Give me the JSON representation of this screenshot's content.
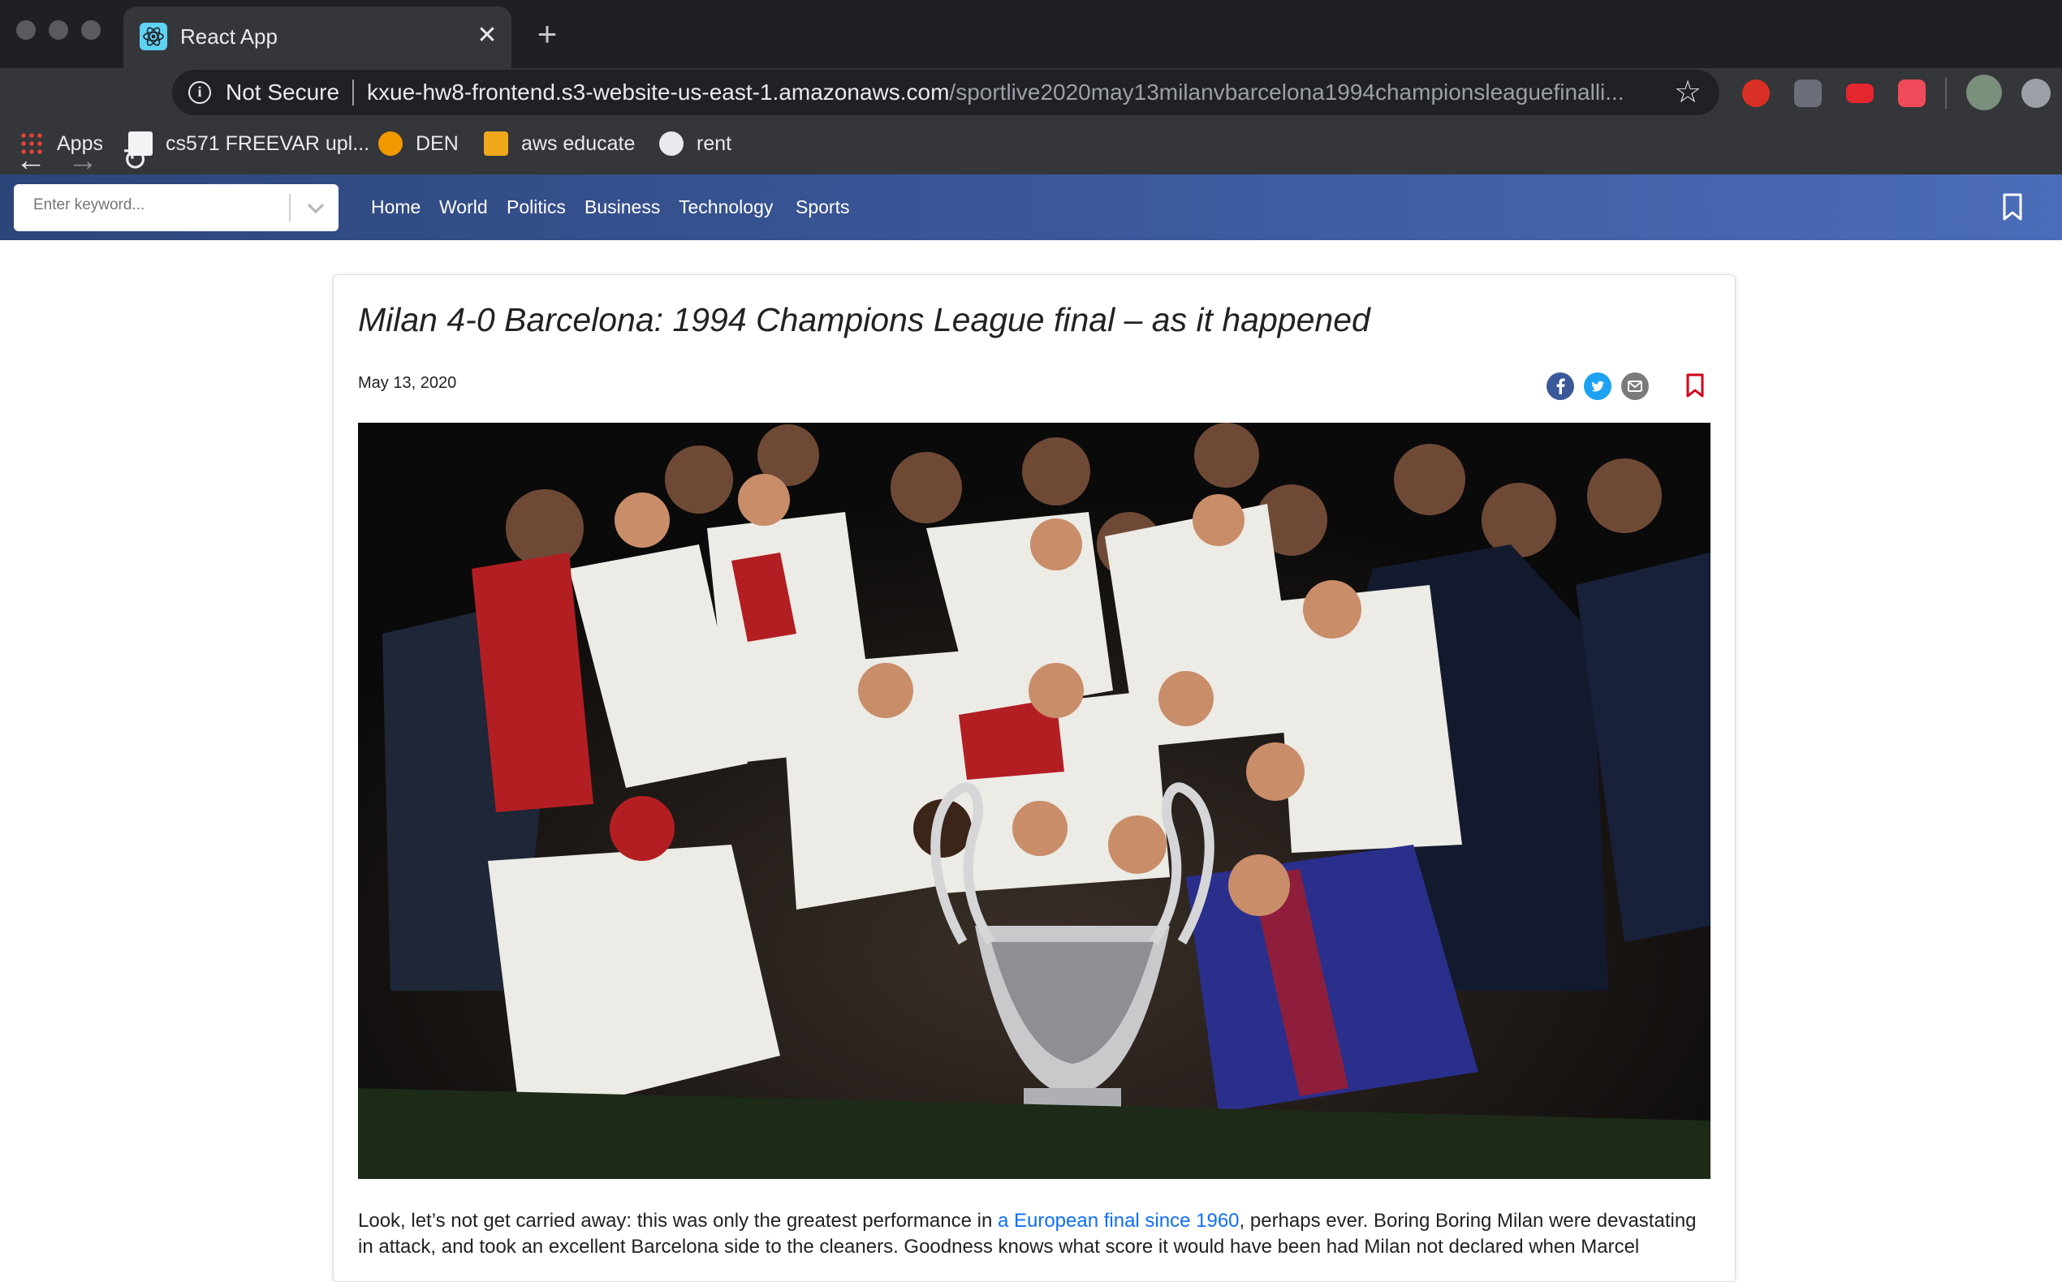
{
  "browser": {
    "tab": {
      "title": "React App",
      "close_glyph": "✕"
    },
    "new_tab_glyph": "+",
    "nav": {
      "back": "←",
      "forward": "→",
      "reload": "↻"
    },
    "omnibox": {
      "security_label": "Not Secure",
      "url_host": "kxue-hw8-frontend.s3-website-us-east-1.amazonaws.com",
      "url_path": "/sportlive2020may13milanvbarcelona1994championsleaguefinalli..."
    },
    "bookmarks": [
      {
        "label": "Apps",
        "icon": "apps-grid-icon"
      },
      {
        "label": "cs571 FREEVAR upl...",
        "icon": "upload-page-icon"
      },
      {
        "label": "DEN",
        "icon": "den-icon"
      },
      {
        "label": "aws educate",
        "icon": "aws-box-icon"
      },
      {
        "label": "rent",
        "icon": "globe-icon"
      }
    ]
  },
  "navbar": {
    "search_placeholder": "Enter keyword...",
    "links": [
      "Home",
      "World",
      "Politics",
      "Business",
      "Technology",
      "Sports"
    ],
    "colors": {
      "gradient_start": "#2d4579",
      "gradient_end": "#4b6cb8"
    }
  },
  "article": {
    "title": "Milan 4-0 Barcelona: 1994 Champions League final – as it happened",
    "date": "May 13, 2020",
    "share_icons": [
      "facebook-icon",
      "twitter-icon",
      "email-icon"
    ],
    "image_alt": "Milan players celebrating with the Champions League trophy",
    "body_prefix": "Look, let’s not get carried away: this was only the greatest performance in ",
    "body_link": "a European final since 1960",
    "body_suffix": ", perhaps ever. Boring Boring Milan were devastating in attack, and took an excellent Barcelona side to the cleaners. Goodness knows what score it would have been had Milan not declared when Marcel"
  }
}
